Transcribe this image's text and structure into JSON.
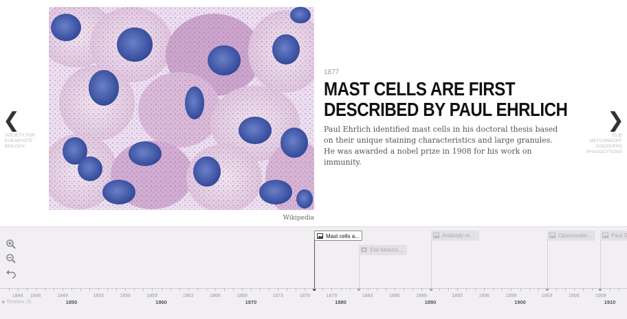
{
  "slide": {
    "date": "1877",
    "headline": "Mast cells are first described by Paul Ehrlich",
    "description": "Paul Ehrlich identified mast cells in his doctoral thesis based on their unique staining characteristics and large granules. He was awarded a nobel prize in 1908 for his work on immunity.",
    "media_credit": "Wikipedia",
    "media_icon": "microscope-image"
  },
  "nav": {
    "prev_arrow": "❮",
    "prev_title": "Society for eukaryote biology",
    "next_arrow": "❯",
    "next_title": "Elie Metchnikoff discovers phagocytosis"
  },
  "timenav": {
    "markers": [
      {
        "label": "Mast cells a...",
        "state": "active",
        "icon": "image-icon"
      },
      {
        "label": "Elie Metchn...",
        "state": "dim",
        "icon": "video-icon"
      },
      {
        "label": "Antibody re...",
        "state": "dim",
        "icon": "image-icon"
      },
      {
        "label": "Opsonisatio...",
        "state": "dim",
        "icon": "image-icon"
      },
      {
        "label": "Paul S...",
        "state": "dim",
        "icon": "image-icon"
      }
    ],
    "minor_ticks": [
      "1844",
      "1846",
      "1849",
      "1853",
      "1856",
      "1859",
      "1863",
      "1866",
      "1869",
      "1873",
      "1876",
      "1879",
      "1883",
      "1886",
      "1889",
      "1893",
      "1896",
      "1899",
      "1903",
      "1906",
      "1909"
    ],
    "major_ticks": [
      "1850",
      "1860",
      "1870",
      "1880",
      "1890",
      "1900",
      "1910"
    ],
    "attribution": "Timeline JS"
  },
  "colors": {
    "accent": "#222222",
    "stain_blue": "#3d5aa8",
    "stain_pink": "#c9a2c9"
  }
}
